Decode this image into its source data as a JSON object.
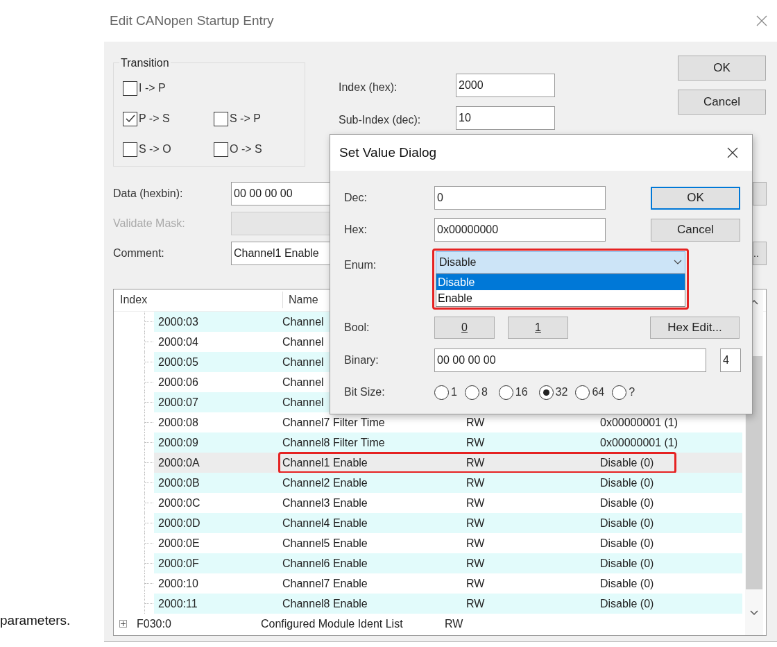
{
  "window": {
    "title": "Edit CANopen Startup Entry"
  },
  "caption": "parameters.",
  "transition": {
    "label": "Transition",
    "options": [
      {
        "label": "I -> P",
        "checked": false
      },
      {
        "label": "P -> S",
        "checked": true
      },
      {
        "label": "S -> P",
        "checked": false
      },
      {
        "label": "S -> O",
        "checked": false
      },
      {
        "label": "O -> S",
        "checked": false
      }
    ]
  },
  "index_field": {
    "label": "Index (hex):",
    "value": "2000"
  },
  "subindex_field": {
    "label": "Sub-Index (dec):",
    "value": "10"
  },
  "buttons": [
    "OK",
    "Cancel"
  ],
  "data_field": {
    "label": "Data (hexbin):",
    "value": "00 00 00 00"
  },
  "validate_mask": {
    "label": "Validate Mask:",
    "disabled": true
  },
  "comment_field": {
    "label": "Comment:",
    "value": "Channel1 Enable",
    "button": ".."
  },
  "table": {
    "columns": [
      "Index",
      "Name"
    ],
    "rows": [
      {
        "index": "2000:03",
        "name": "Channel",
        "selected": false,
        "highlighted": false
      },
      {
        "index": "2000:04",
        "name": "Channel",
        "selected": false,
        "highlighted": false
      },
      {
        "index": "2000:05",
        "name": "Channel",
        "selected": false,
        "highlighted": false
      },
      {
        "index": "2000:06",
        "name": "Channel",
        "selected": false,
        "highlighted": false
      },
      {
        "index": "2000:07",
        "name": "Channel",
        "selected": false,
        "highlighted": false
      },
      {
        "index": "2000:08",
        "name": "Channel7 Filter Time",
        "access": "RW",
        "value": "0x00000001 (1)",
        "selected": false,
        "highlighted": false
      },
      {
        "index": "2000:09",
        "name": "Channel8 Filter Time",
        "access": "RW",
        "value": "0x00000001 (1)",
        "selected": false,
        "highlighted": false
      },
      {
        "index": "2000:0A",
        "name": "Channel1 Enable",
        "access": "RW",
        "value": "Disable (0)",
        "selected": true,
        "highlighted": true
      },
      {
        "index": "2000:0B",
        "name": "Channel2 Enable",
        "access": "RW",
        "value": "Disable (0)",
        "selected": false,
        "highlighted": false
      },
      {
        "index": "2000:0C",
        "name": "Channel3 Enable",
        "access": "RW",
        "value": "Disable (0)",
        "selected": false,
        "highlighted": false
      },
      {
        "index": "2000:0D",
        "name": "Channel4 Enable",
        "access": "RW",
        "value": "Disable (0)",
        "selected": false,
        "highlighted": false
      },
      {
        "index": "2000:0E",
        "name": "Channel5 Enable",
        "access": "RW",
        "value": "Disable (0)",
        "selected": false,
        "highlighted": false
      },
      {
        "index": "2000:0F",
        "name": "Channel6 Enable",
        "access": "RW",
        "value": "Disable (0)",
        "selected": false,
        "highlighted": false
      },
      {
        "index": "2000:10",
        "name": "Channel7 Enable",
        "access": "RW",
        "value": "Disable (0)",
        "selected": false,
        "highlighted": false
      },
      {
        "index": "2000:11",
        "name": "Channel8 Enable",
        "access": "RW",
        "value": "Disable (0)",
        "selected": false,
        "highlighted": false
      }
    ],
    "next_row": {
      "index": "F030:0",
      "name": "Configured Module Ident List",
      "access": "RW"
    }
  },
  "set_value_dialog": {
    "title": "Set Value Dialog",
    "dec": {
      "label": "Dec:",
      "value": "0"
    },
    "hex": {
      "label": "Hex:",
      "value": "0x00000000"
    },
    "buttons": [
      {
        "label": "OK",
        "default": true
      },
      {
        "label": "Cancel",
        "default": false
      }
    ],
    "enum": {
      "label": "Enum:",
      "value": "Disable",
      "highlighted": true,
      "expanded": true,
      "options": [
        {
          "label": "Disable",
          "selected": true
        },
        {
          "label": "Enable",
          "selected": false
        }
      ]
    },
    "bool": {
      "label": "Bool:",
      "buttons": [
        "0",
        "1"
      ]
    },
    "hex_edit_button": "Hex Edit...",
    "binary": {
      "label": "Binary:",
      "value": "00 00 00 00",
      "size": "4"
    },
    "bit_size": {
      "label": "Bit Size:",
      "options": [
        {
          "label": "1",
          "selected": false
        },
        {
          "label": "8",
          "selected": false
        },
        {
          "label": "16",
          "selected": false
        },
        {
          "label": "32",
          "selected": true
        },
        {
          "label": "64",
          "selected": false
        },
        {
          "label": "?",
          "selected": false
        }
      ]
    }
  }
}
